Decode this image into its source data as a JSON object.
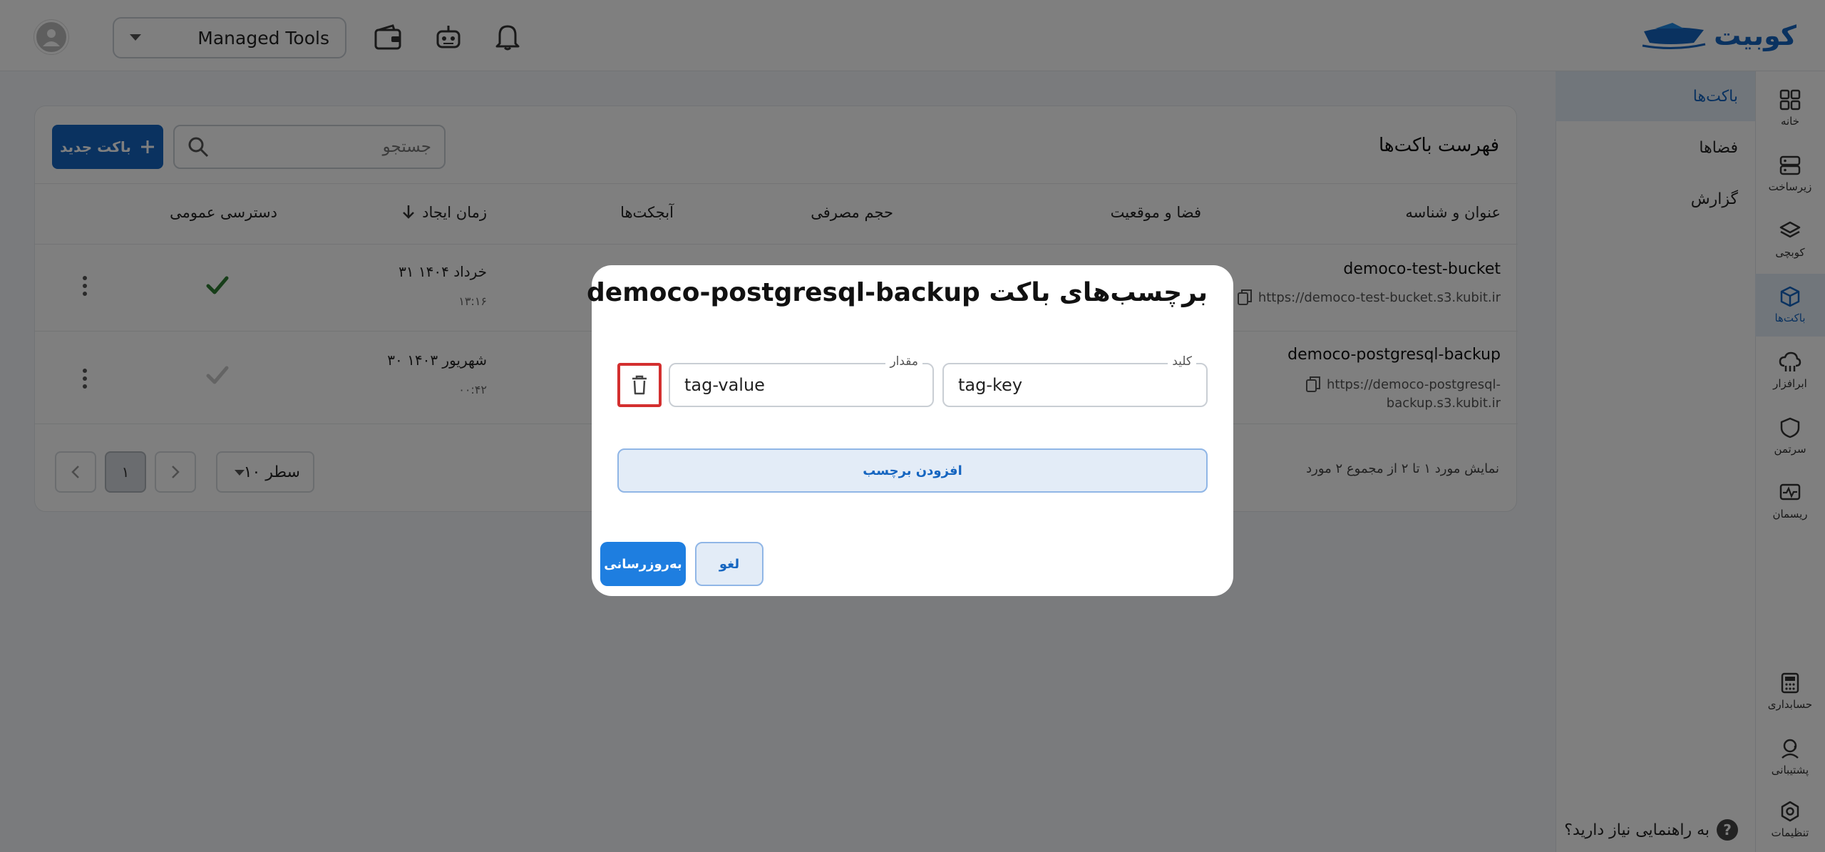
{
  "app": {
    "logo_text": "کوبیت"
  },
  "header": {
    "tools_select_value": "Managed Tools"
  },
  "rail": {
    "items": [
      {
        "label": "خانه",
        "icon": "grid-icon"
      },
      {
        "label": "زیرساخت",
        "icon": "server-icon"
      },
      {
        "label": "کوبچی",
        "icon": "layers-icon"
      },
      {
        "label": "باکت‌ها",
        "icon": "cube-icon"
      },
      {
        "label": "ابرافزار",
        "icon": "cloud-icon"
      },
      {
        "label": "سرتمن",
        "icon": "shield-icon"
      },
      {
        "label": "ریسمان",
        "icon": "monitor-icon"
      },
      {
        "label": "حسابداری",
        "icon": "calculator-icon"
      },
      {
        "label": "پشتیبانی",
        "icon": "support-icon"
      },
      {
        "label": "تنظیمات",
        "icon": "gear-icon"
      }
    ]
  },
  "subnav": {
    "items": [
      {
        "label": "باکت‌ها"
      },
      {
        "label": "فضاها"
      },
      {
        "label": "گزارش"
      }
    ],
    "help_text": "به راهنمایی نیاز دارید؟",
    "help_symbol": "?"
  },
  "buckets": {
    "title": "فهرست باکت‌ها",
    "new_button": "باکت جدید",
    "search_placeholder": "جستجو",
    "columns": {
      "name": "عنوان و شناسه",
      "space": "فضا و موقعیت",
      "usage": "حجم مصرفی",
      "objects": "آبجکت‌ها",
      "created": "زمان ایجاد",
      "public": "دسترسی عمومی"
    },
    "rows": [
      {
        "name": "democo-test-bucket",
        "url_line1": "https://democo-test-bucket.s3.kubit.ir",
        "url_line2": "",
        "date": "۳۱ خرداد ۱۴۰۴",
        "time": "۱۳:۱۶",
        "public": true
      },
      {
        "name": "democo-postgresql-backup",
        "url_line1": "https://democo-postgresql-",
        "url_line2": "backup.s3.kubit.ir",
        "date": "۳۰ شهریور ۱۴۰۳",
        "time": "۰۰:۴۲",
        "public": false
      }
    ],
    "pagination": {
      "info": "نمایش مورد ۱ تا ۲ از مجموع ۲ مورد",
      "current_page": "۱",
      "rows_per_page": "۱۰ سطر"
    }
  },
  "modal": {
    "title": "برچسب‌های باکت democo-postgresql-backup",
    "key_label": "کلید",
    "key_value": "tag-key",
    "value_label": "مقدار",
    "value_value": "tag-value",
    "add_tag": "افزودن برچسب",
    "cancel": "لغو",
    "update": "به‌روزرسانی"
  },
  "colors": {
    "primary": "#1565c0",
    "highlight": "#d32f2f",
    "success": "#2e7d32"
  }
}
